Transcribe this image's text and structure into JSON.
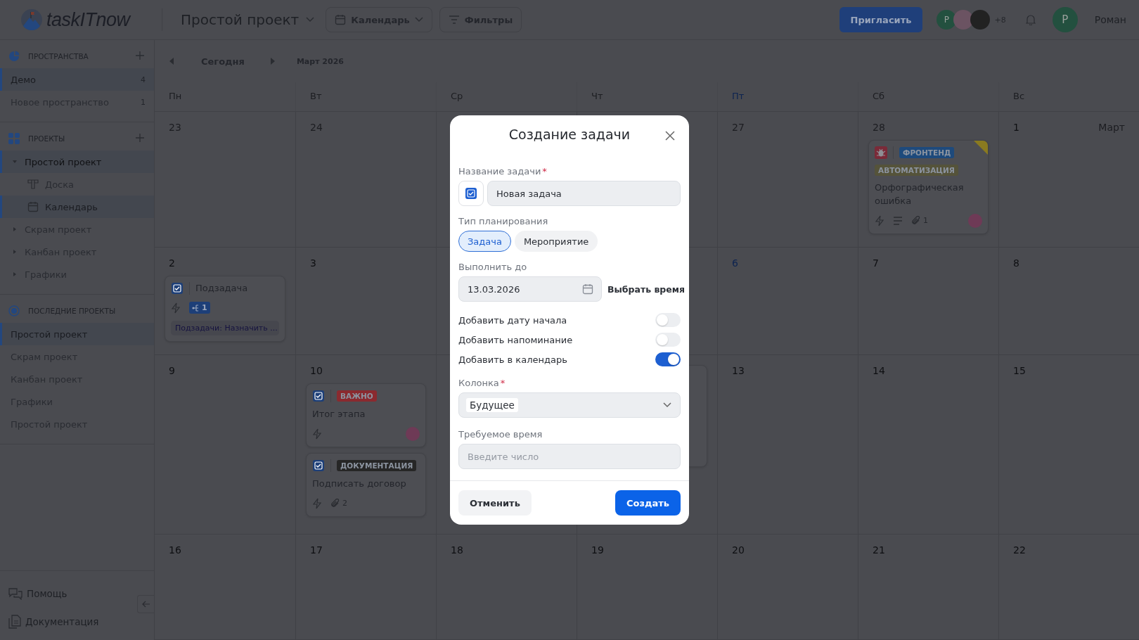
{
  "header": {
    "logo": "taskITnow",
    "project": "Простой проект",
    "view_button": "Календарь",
    "filter_button": "Фильтры",
    "invite_button": "Пригласить",
    "members": [
      {
        "kind": "letter",
        "text": "Р",
        "color": "#23503f"
      },
      {
        "kind": "plain",
        "color": "#6b5362"
      },
      {
        "kind": "plain",
        "color": "#222222"
      }
    ],
    "more_members": "+8",
    "user": {
      "initial": "Р",
      "name": "Роман"
    }
  },
  "sidebar": {
    "sections": [
      {
        "kind": "spaces",
        "title": "ПРОСТРАНСТВА",
        "items": [
          {
            "label": "Демо",
            "count": "4",
            "selected": true
          },
          {
            "label": "Новое пространство",
            "count": "1",
            "selected": false
          }
        ]
      },
      {
        "kind": "projects",
        "title": "ПРОЕКТЫ",
        "items": [
          {
            "label": "Простой проект",
            "expanded": true,
            "selected": true,
            "children": [
              {
                "label": "Доска",
                "kind": "board",
                "selected": false
              },
              {
                "label": "Календарь",
                "kind": "calendar",
                "selected": true
              }
            ]
          },
          {
            "label": "Скрам проект",
            "expanded": false,
            "selected": false
          },
          {
            "label": "Канбан проект",
            "expanded": false,
            "selected": false
          },
          {
            "label": "Графики",
            "expanded": false,
            "selected": false
          }
        ]
      },
      {
        "kind": "recent",
        "title": "ПОСЛЕДНИЕ ПРОЕКТЫ",
        "items": [
          {
            "label": "Простой проект",
            "selected": true
          },
          {
            "label": "Скрам проект",
            "selected": false
          },
          {
            "label": "Канбан проект",
            "selected": false
          },
          {
            "label": "Графики",
            "selected": false
          },
          {
            "label": "Простой проект",
            "selected": false
          }
        ]
      }
    ],
    "footer": [
      {
        "kind": "help",
        "label": "Помощь"
      },
      {
        "kind": "docs",
        "label": "Документация"
      }
    ]
  },
  "calendar": {
    "today_button": "Сегодня",
    "month": "Март 2026",
    "weekdays": [
      {
        "label": "Пн",
        "today": false
      },
      {
        "label": "Вт",
        "today": false
      },
      {
        "label": "Ср",
        "today": false
      },
      {
        "label": "Чт",
        "today": false
      },
      {
        "label": "Пт",
        "today": true
      },
      {
        "label": "Сб",
        "today": false
      },
      {
        "label": "Вс",
        "today": false
      }
    ],
    "weeks": [
      [
        {
          "kind": "day",
          "day": "23",
          "muted": true
        },
        {
          "kind": "day",
          "day": "24",
          "muted": true
        },
        {
          "kind": "covered"
        },
        {
          "kind": "covered"
        },
        {
          "kind": "day",
          "day": "27",
          "muted": true
        },
        {
          "kind": "day",
          "day": "28",
          "muted": true,
          "cards": [
            {
              "kind": "bug",
              "tags": [
                {
                  "label": "ФРОНТЕНД",
                  "color": "#1e4a7c"
                },
                {
                  "label": "АВТОМАТИЗАЦИЯ",
                  "color": "#55533a"
                }
              ],
              "title": "Орфографическая ошибка",
              "color": "#8a7a20",
              "meta": [
                {
                  "kind": "bolt"
                },
                {
                  "kind": "lines"
                },
                {
                  "kind": "clip",
                  "count": "1"
                },
                {
                  "kind": "avatar"
                }
              ]
            }
          ]
        },
        {
          "kind": "day",
          "day": "1",
          "muted": false,
          "month_label": "Март"
        }
      ],
      [
        {
          "kind": "day",
          "day": "2",
          "muted": false,
          "cards": [
            {
              "kind": "inline",
              "title": "Подзадача",
              "meta": [
                {
                  "kind": "bolt"
                },
                {
                  "kind": "subtasks",
                  "count": "1"
                }
              ],
              "note": "Подзадачи: Назначить ..."
            }
          ]
        },
        {
          "kind": "day",
          "day": "3",
          "muted": false
        },
        {
          "kind": "covered"
        },
        {
          "kind": "covered"
        },
        {
          "kind": "day",
          "day": "6",
          "muted": false,
          "today": true
        },
        {
          "kind": "day",
          "day": "7",
          "muted": false
        },
        {
          "kind": "day",
          "day": "8",
          "muted": false
        }
      ],
      [
        {
          "kind": "day",
          "day": "9",
          "muted": false
        },
        {
          "kind": "day",
          "day": "10",
          "muted": false,
          "cards": [
            {
              "kind": "task",
              "tags": [
                {
                  "label": "ВАЖНО",
                  "color": "#8a2a2f"
                }
              ],
              "title": "Итог этапа",
              "meta": [
                {
                  "kind": "bolt"
                },
                {
                  "kind": "avatar"
                }
              ]
            },
            {
              "kind": "task",
              "tags": [
                {
                  "label": "ДОКУМЕНТАЦИЯ",
                  "color": "#262626"
                }
              ],
              "title": "Подписать договор",
              "meta": [
                {
                  "kind": "bolt"
                },
                {
                  "kind": "clip",
                  "count": "2"
                }
              ]
            }
          ]
        },
        {
          "kind": "covered"
        },
        {
          "kind": "covered",
          "cards": [
            {
              "kind": "hidden"
            }
          ]
        },
        {
          "kind": "day",
          "day": "13",
          "muted": false
        },
        {
          "kind": "day",
          "day": "14",
          "muted": false
        },
        {
          "kind": "day",
          "day": "15",
          "muted": false
        }
      ],
      [
        {
          "kind": "day",
          "day": "16",
          "muted": false
        },
        {
          "kind": "day",
          "day": "17",
          "muted": false
        },
        {
          "kind": "day",
          "day": "18",
          "muted": false
        },
        {
          "kind": "day",
          "day": "19",
          "muted": false
        },
        {
          "kind": "day",
          "day": "20",
          "muted": false
        },
        {
          "kind": "day",
          "day": "21",
          "muted": false
        },
        {
          "kind": "day",
          "day": "22",
          "muted": false
        }
      ]
    ]
  },
  "modal": {
    "title": "Создание задачи",
    "name_label": "Название задачи",
    "name_required_mark": "*",
    "name_value": "Новая задача",
    "type_label": "Тип планирования",
    "types": [
      {
        "label": "Задача",
        "selected": true
      },
      {
        "label": "Мероприятие",
        "selected": false
      }
    ],
    "due_label": "Выполнить до",
    "due_value": "13.03.2026",
    "time_link": "Выбрать время",
    "toggles": [
      {
        "label": "Добавить дату начала",
        "on": false
      },
      {
        "label": "Добавить напоминание",
        "on": false
      },
      {
        "label": "Добавить в календарь",
        "on": true
      }
    ],
    "column_label": "Колонка",
    "column_required_mark": "*",
    "column_value": "Будущее",
    "estimate_label": "Требуемое время",
    "estimate_placeholder": "Введите число",
    "cancel_button": "Отменить",
    "create_button": "Создать"
  }
}
